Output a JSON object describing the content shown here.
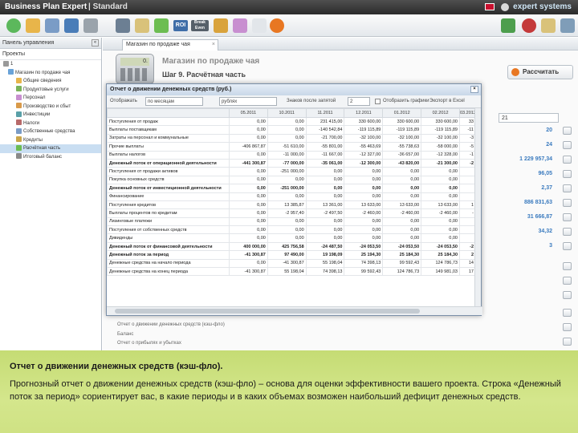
{
  "titlebar": {
    "app": "Business Plan Expert",
    "edition": "| Standard",
    "brand": "expert systems"
  },
  "toolbar": {
    "roi_label": "ROI",
    "breakeven_label": "Break Even"
  },
  "left_panel": {
    "header": "Панель управления",
    "subheader": "Проекты",
    "items": [
      "1",
      "Магазин по продаже чая",
      "Общие сведения",
      "Продуктовые услуги",
      "Персонал",
      "Производство и сбыт",
      "Инвестиции",
      "Налоги",
      "Собственные средства",
      "Кредиты",
      "Расчётная часть",
      "Итоговый баланс"
    ],
    "selected_index": 10
  },
  "main": {
    "tab_label": "Магазин по продаже чая",
    "calc_display": "0.",
    "project_title": "Магазин по продаже чая",
    "step_title": "Шаг 9. Расчётная часть",
    "calculate_button": "Рассчитать",
    "input_value": "21",
    "right_values": [
      "20",
      "24",
      "1 229 957,34",
      "96,05",
      "2,37",
      "886 831,63",
      "31 666,87",
      "34,32",
      "3"
    ],
    "lower_rows": [
      "Отчет о движении денежных средств (кэш-фло)",
      "Баланс",
      "Отчет о прибылях и убытках"
    ]
  },
  "dialog": {
    "title": "Отчет о движении денежных средств (руб.)",
    "toolbar": {
      "display_label": "Отображать",
      "period_value": "по месяцам",
      "currency_value": "рублях",
      "decimals_label": "Знаков после запятой",
      "decimals_value": "2",
      "option_label": "Отобразить графики",
      "export_label": "Экспорт в Excel"
    },
    "columns": [
      "",
      "05.2011",
      "10.2011",
      "11.2011",
      "12.2011",
      "01.2012",
      "02.2012",
      "03.2012"
    ],
    "rows": [
      {
        "label": "Поступления от продаж",
        "values": [
          "0,00",
          "0,00",
          "231 415,00",
          "330 600,00",
          "330 600,00",
          "330 600,00",
          "33"
        ],
        "bold": false
      },
      {
        "label": "Выплаты поставщикам",
        "values": [
          "0,00",
          "0,00",
          "-140 542,84",
          "-119 115,89",
          "-119 115,89",
          "-119 115,89",
          "-11"
        ],
        "bold": false
      },
      {
        "label": "Затраты на персонал и коммунальные",
        "values": [
          "0,00",
          "0,00",
          "-21 700,00",
          "-32 100,00",
          "-32 100,00",
          "-32 100,00",
          "-3"
        ],
        "bold": false
      },
      {
        "label": "Прочие выплаты",
        "values": [
          "-406 867,87",
          "-51 610,00",
          "-55 801,00",
          "-55 463,69",
          "-55 738,63",
          "-58 000,00",
          "-5"
        ],
        "bold": false
      },
      {
        "label": "Выплаты налогов",
        "values": [
          "0,00",
          "-11 000,00",
          "-11 667,00",
          "-12 327,00",
          "-36 657,00",
          "-12 328,00",
          "-1"
        ],
        "bold": false
      },
      {
        "label": "Денежный поток от операционной деятельности",
        "values": [
          "-441 300,87",
          "-77 000,00",
          "-35 061,00",
          "-12 300,00",
          "-43 820,00",
          "-21 300,00",
          "-2"
        ],
        "bold": true
      },
      {
        "label": "Поступления от продажи активов",
        "values": [
          "0,00",
          "-251 000,00",
          "0,00",
          "0,00",
          "0,00",
          "0,00",
          ""
        ],
        "bold": false
      },
      {
        "label": "Покупка основных средств",
        "values": [
          "0,00",
          "0,00",
          "0,00",
          "0,00",
          "0,00",
          "0,00",
          ""
        ],
        "bold": false
      },
      {
        "label": "Денежный поток от инвестиционной деятельности",
        "values": [
          "0,00",
          "-251 000,00",
          "0,00",
          "0,00",
          "0,00",
          "0,00",
          ""
        ],
        "bold": true
      },
      {
        "label": "Финансирование",
        "values": [
          "0,00",
          "0,00",
          "0,00",
          "0,00",
          "0,00",
          "0,00",
          ""
        ],
        "bold": false
      },
      {
        "label": "Поступления кредитов",
        "values": [
          "0,00",
          "13 385,87",
          "13 361,00",
          "13 633,00",
          "13 633,00",
          "13 633,00",
          "1"
        ],
        "bold": false
      },
      {
        "label": "Выплаты процентов по кредитам",
        "values": [
          "0,00",
          "-2 957,40",
          "-2 497,50",
          "-2 460,00",
          "-2 460,00",
          "-2 460,00",
          "-"
        ],
        "bold": false
      },
      {
        "label": "Лизинговые платежи",
        "values": [
          "0,00",
          "0,00",
          "0,00",
          "0,00",
          "0,00",
          "0,00",
          ""
        ],
        "bold": false
      },
      {
        "label": "Поступления от собственных средств",
        "values": [
          "0,00",
          "0,00",
          "0,00",
          "0,00",
          "0,00",
          "0,00",
          ""
        ],
        "bold": false
      },
      {
        "label": "Дивиденды",
        "values": [
          "0,00",
          "0,00",
          "0,00",
          "0,00",
          "0,00",
          "0,00",
          ""
        ],
        "bold": false
      },
      {
        "label": "Денежный поток от финансовой деятельности",
        "values": [
          "400 000,00",
          "425 756,58",
          "-24 487,50",
          "-24 053,50",
          "-24 053,50",
          "-24 053,50",
          "-2"
        ],
        "bold": true
      },
      {
        "label": "Денежный поток за период",
        "values": [
          "-41 300,87",
          "97 490,00",
          "19 198,09",
          "25 194,30",
          "25 184,30",
          "25 184,30",
          "2"
        ],
        "bold": true
      },
      {
        "label": "Денежные средства на начало периода",
        "values": [
          "0,00",
          "-41 300,87",
          "55 198,04",
          "74 398,13",
          "99 592,43",
          "124 786,73",
          "14"
        ],
        "bold": false
      },
      {
        "label": "Денежные средства на конец периода",
        "values": [
          "-41 300,87",
          "55 198,04",
          "74 398,13",
          "99 592,43",
          "124 786,73",
          "149 981,03",
          "17"
        ],
        "bold": false
      }
    ]
  },
  "caption": {
    "title": "Отчет о движении денежных средств (кэш-фло).",
    "body": "Прогнозный отчет о движении денежных средств (кэш-фло) – основа для оценки эффективности вашего проекта. Строка «Денежный поток за период» сориентирует вас, в какие периоды и в каких объемах возможен наибольший дефицит денежных средств."
  },
  "colors": {
    "caption_bg": "#c5dc74",
    "accent_blue": "#3b7bbf",
    "titlebar": "#2b2b2b"
  }
}
